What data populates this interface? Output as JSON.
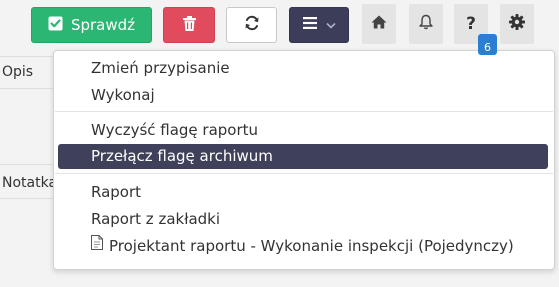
{
  "toolbar": {
    "check_label": "Sprawdź",
    "help_symbol": "?",
    "notification_count": "6"
  },
  "sidebar": {
    "opis_label": "Opis",
    "notatka_label": "Notatka"
  },
  "dropdown": {
    "items": [
      "Zmień przypisanie",
      "Wykonaj",
      "Wyczyść flagę raportu",
      "Przełącz flagę archiwum",
      "Raport",
      "Raport z zakładki",
      "Projektant raportu - Wykonanie inspekcji (Pojedynczy)"
    ],
    "active_item": "Przełącz flagę archiwum"
  },
  "icons": {
    "check": "check-square-icon",
    "delete": "trash-icon",
    "refresh": "refresh-icon",
    "menu": "list-icon",
    "caret": "chevron-down-icon",
    "home": "home-icon",
    "bell": "bell-icon",
    "help": "question-icon",
    "settings": "gear-icon",
    "document": "document-icon"
  },
  "colors": {
    "check_button": "#2bb673",
    "delete_button": "#e04b5e",
    "menu_button": "#3c3d58",
    "active_item": "#3f405a",
    "badge": "#2a7fd0"
  }
}
